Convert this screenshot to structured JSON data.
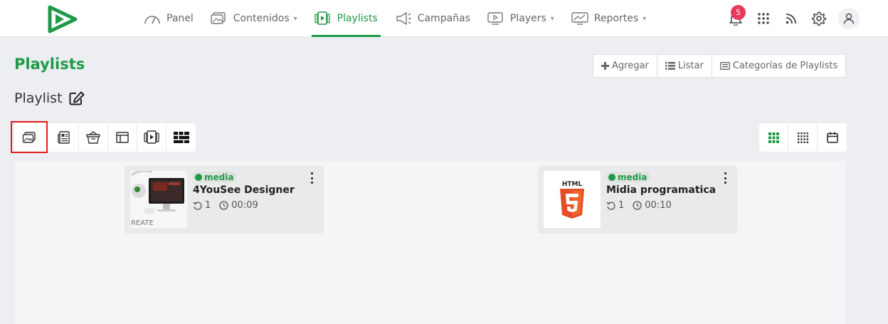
{
  "nav": {
    "items": [
      {
        "label": "Panel",
        "icon": "gauge-icon",
        "dropdown": false,
        "active": false
      },
      {
        "label": "Contenidos",
        "icon": "images-icon",
        "dropdown": true,
        "active": false
      },
      {
        "label": "Playlists",
        "icon": "playlist-icon",
        "dropdown": false,
        "active": true
      },
      {
        "label": "Campañas",
        "icon": "megaphone-icon",
        "dropdown": false,
        "active": false
      },
      {
        "label": "Players",
        "icon": "player-icon",
        "dropdown": true,
        "active": false
      },
      {
        "label": "Reportes",
        "icon": "report-icon",
        "dropdown": true,
        "active": false
      }
    ],
    "notifications_count": "5",
    "accent": "#1f9a48",
    "badge_color": "#e8395d"
  },
  "page": {
    "title": "Playlists",
    "subtitle": "Playlist"
  },
  "actions": {
    "add": "Agregar",
    "list": "Listar",
    "categories": "Categorías de Playlists"
  },
  "toolbar": {
    "tools": [
      "media-icon",
      "news-icon",
      "basket-icon",
      "layout-icon",
      "playlist-icon",
      "grid-blocks-icon"
    ],
    "selected_tool": "media-icon",
    "views": [
      "grid-large-icon",
      "grid-small-icon",
      "calendar-icon"
    ],
    "selected_view": "grid-large-icon"
  },
  "cards": [
    {
      "tag": "media",
      "title": "4YouSee Designer",
      "loops": "1",
      "duration": "00:09",
      "thumb_text": "REATE"
    },
    {
      "tag": "media",
      "title": "Midia programatica",
      "loops": "1",
      "duration": "00:10",
      "thumb_text": "HTML"
    }
  ]
}
